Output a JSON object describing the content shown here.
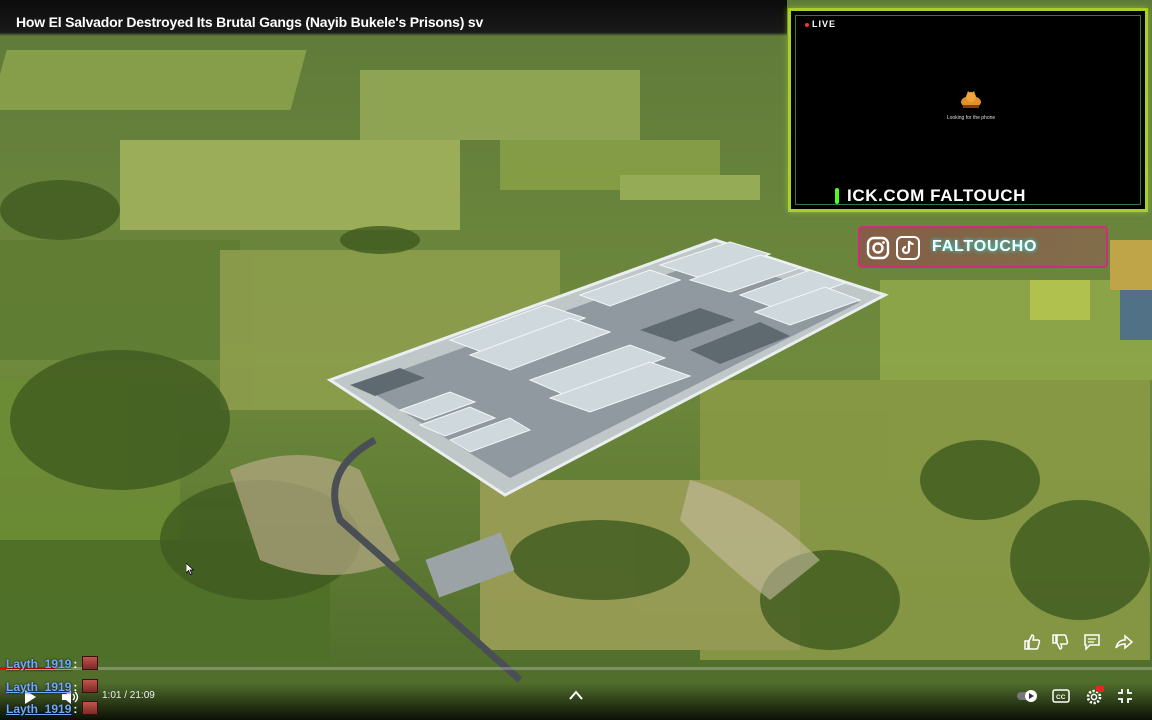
{
  "video": {
    "title": "How El Salvador Destroyed Its Brutal Gangs (Nayib Bukele's Prisons) sv",
    "current_time": "1:01",
    "duration": "21:09",
    "time_display": "1:01 / 21:09",
    "progress_fraction": 0.048
  },
  "webcam": {
    "live_label": "LIVE",
    "status_text": "Looking for the phone",
    "kick_text": "ICK.COM FALTOUCH"
  },
  "social": {
    "handle": "FALTOUCHO",
    "icons": [
      "instagram-icon",
      "tiktok-icon"
    ]
  },
  "side_actions": [
    "thumbs-up-icon",
    "thumbs-down-icon",
    "comment-icon",
    "share-icon"
  ],
  "controls": {
    "left": [
      "play-icon",
      "volume-icon"
    ],
    "center": [
      "chevron-up-icon"
    ],
    "right": [
      "autoplay-toggle",
      "captions-icon",
      "settings-icon",
      "fullscreen-exit-icon"
    ],
    "settings_badge": "HD"
  },
  "chat": {
    "messages": [
      {
        "user": "Layth_1919",
        "separator": ":"
      },
      {
        "user": "Layth_1919",
        "separator": ":"
      },
      {
        "user": "Layth_1919",
        "separator": ":"
      }
    ]
  },
  "colors": {
    "webcam_border": "#a8cf2c",
    "social_border": "#d12c7b",
    "progress": "#ff0000",
    "chat_user": "#6fa8ff"
  }
}
